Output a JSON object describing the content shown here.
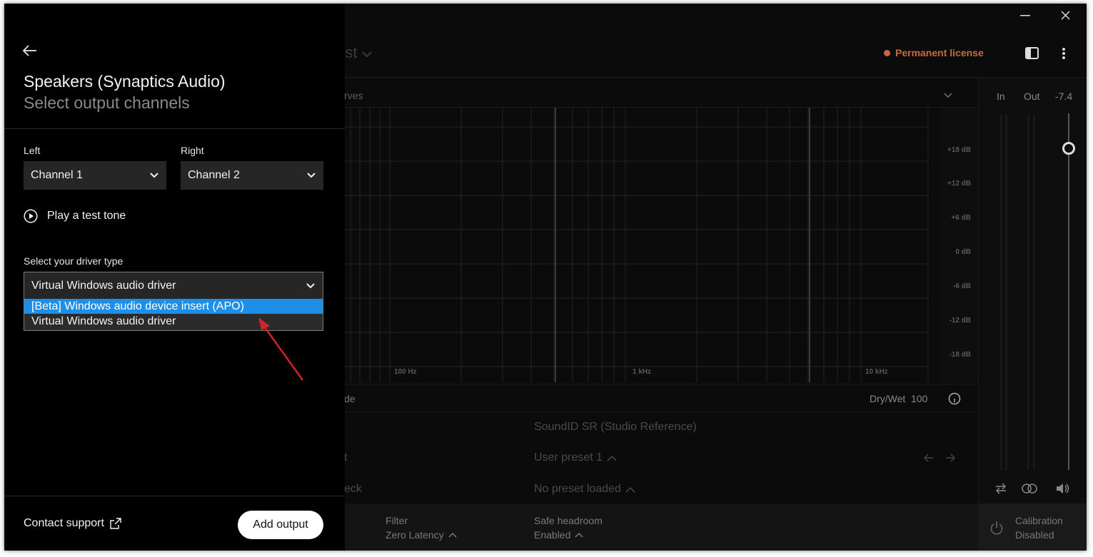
{
  "window": {
    "controls": [
      "minimize-icon",
      "close-icon"
    ]
  },
  "header": {
    "preset_title_fragment": "rst",
    "license": "Permanent license",
    "license_color": "#c86b3a"
  },
  "graph": {
    "header_fragment": "rves",
    "db_labels": [
      "+18 dB",
      "+12 dB",
      "+6 dB",
      "0 dB",
      "-6 dB",
      "-12 dB",
      "-18 dB"
    ],
    "hz_labels": [
      "100 Hz",
      "1 kHz",
      "10 kHz"
    ]
  },
  "meters": {
    "in_label": "In",
    "out_label": "Out",
    "volume": "-7.4"
  },
  "mix_row": {
    "left_fragment": "de",
    "drywet_label": "Dry/Wet",
    "drywet_value": "100"
  },
  "profile": {
    "soundid": "SoundID SR (Studio Reference)",
    "left_frag_1": "t",
    "user_preset": "User preset 1",
    "left_frag_2": "eck",
    "no_preset": "No preset loaded"
  },
  "bottom_bar": {
    "filter_label": "Filter",
    "filter_value": "Zero Latency",
    "headroom_label": "Safe headroom",
    "headroom_value": "Enabled",
    "calibration_label": "Calibration",
    "calibration_value": "Disabled"
  },
  "panel": {
    "title": "Speakers (Synaptics Audio)",
    "subtitle": "Select output channels",
    "left_label": "Left",
    "left_value": "Channel 1",
    "right_label": "Right",
    "right_value": "Channel 2",
    "test_tone": "Play a test tone",
    "driver_label": "Select your driver type",
    "driver_value": "Virtual Windows audio driver",
    "driver_options": [
      "[Beta] Windows audio device insert (APO)",
      "Virtual Windows audio driver"
    ],
    "contact": "Contact support",
    "add_output": "Add output"
  },
  "accent_color": "#1e8fe8"
}
